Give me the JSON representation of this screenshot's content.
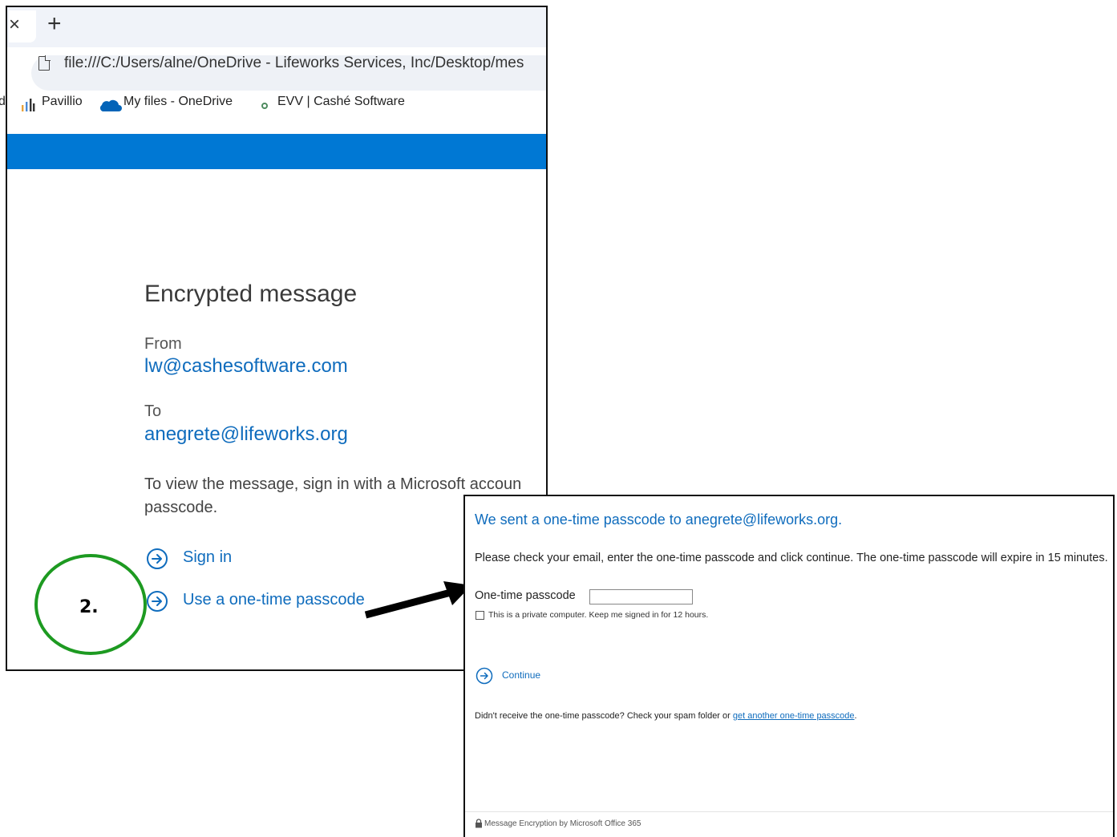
{
  "browser": {
    "tab_close_glyph": "×",
    "new_tab_glyph": "+",
    "url": "file:///C:/Users/alne/OneDrive - Lifeworks Services, Inc/Desktop/mes",
    "bookmark_cut_glyph": "d",
    "bookmarks": [
      {
        "label": "Pavillio",
        "icon": "bar-chart-icon"
      },
      {
        "label": "My files - OneDrive",
        "icon": "onedrive-cloud-icon"
      },
      {
        "label": "EVV | Cashé Software",
        "icon": "site-dot-icon"
      }
    ],
    "header_color": "#0078d4"
  },
  "message": {
    "title": "Encrypted message",
    "from_label": "From",
    "from_email": "lw@cashesoftware.com",
    "to_label": "To",
    "to_email": "anegrete@lifeworks.org",
    "instructions": "To view the message, sign in with a Microsoft accoun passcode.",
    "sign_in_label": "Sign in",
    "otp_label": "Use a one-time passcode"
  },
  "annotation": {
    "step_label": "2.",
    "circle_color": "#1d9a21"
  },
  "otp_page": {
    "heading": "We sent a one-time passcode to anegrete@lifeworks.org.",
    "instructions": "Please check your email, enter the one-time passcode and click continue. The one-time passcode will expire in 15 minutes.",
    "passcode_label": "One-time passcode",
    "passcode_value": "",
    "keep_signed_in_label": "This is a private computer. Keep me signed in for 12 hours.",
    "continue_label": "Continue",
    "didnt_receive_text": "Didn't receive the one-time passcode? Check your spam folder or ",
    "get_another_link": "get another one-time passcode",
    "period": ".",
    "footer": "Message Encryption by Microsoft Office 365",
    "link_color": "#0f6cbd"
  }
}
